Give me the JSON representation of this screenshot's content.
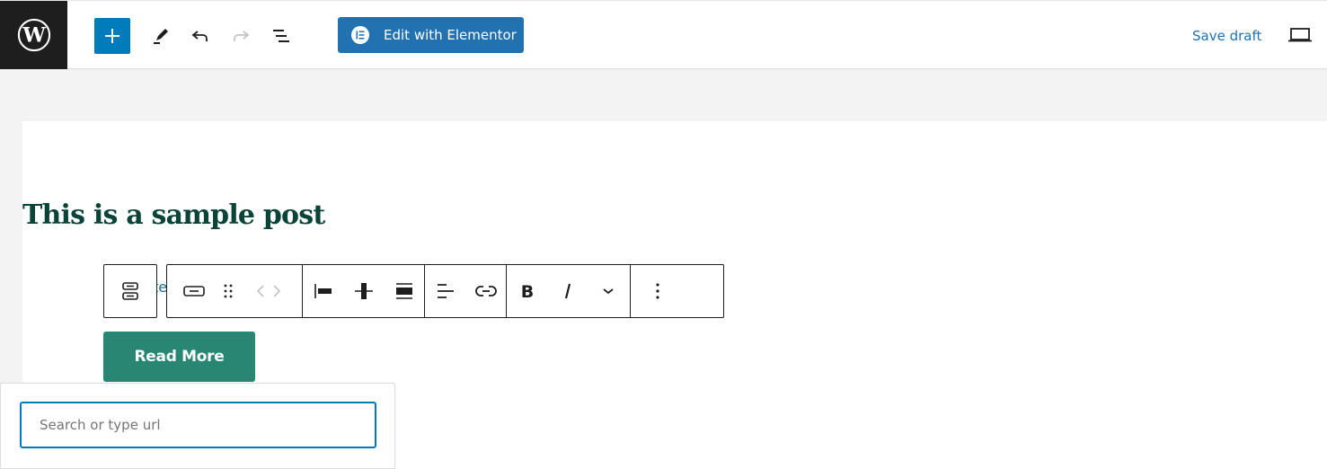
{
  "header": {
    "logo": "wordpress-logo",
    "add_block_label": "+",
    "tools": [
      {
        "name": "tools-icon",
        "label": "Tools"
      },
      {
        "name": "undo-icon",
        "label": "Undo"
      },
      {
        "name": "redo-icon",
        "label": "Redo",
        "disabled": true
      },
      {
        "name": "list-view-icon",
        "label": "Document Overview"
      }
    ],
    "elementor_label": "Edit with Elementor",
    "save_draft_label": "Save draft",
    "preview_icon": "laptop-icon"
  },
  "colors": {
    "accent": "#007cba",
    "elementor": "#2271b1",
    "title": "#0a4438",
    "button": "#288673",
    "dark": "#1e1e1e"
  },
  "post": {
    "title": "This is a sample post",
    "partial_text": "te",
    "button_label": "Read More"
  },
  "block_toolbar": {
    "groups": [
      [
        {
          "name": "buttons-parent-icon",
          "label": "Select Buttons"
        }
      ],
      [
        {
          "name": "button-block-icon",
          "label": "Button"
        },
        {
          "name": "drag-handle-icon",
          "label": "Drag"
        },
        {
          "name": "move-arrows-icon",
          "label": "Move left/right"
        }
      ],
      [
        {
          "name": "align-left-icon",
          "label": "Align left"
        },
        {
          "name": "align-center-icon",
          "label": "Align center"
        },
        {
          "name": "align-wide-icon",
          "label": "Wide width"
        }
      ],
      [
        {
          "name": "justify-icon",
          "label": "Change items justification"
        },
        {
          "name": "link-icon",
          "label": "Link"
        }
      ],
      [
        {
          "name": "bold-icon",
          "label": "Bold"
        },
        {
          "name": "italic-icon",
          "label": "Italic"
        },
        {
          "name": "more-chevron-icon",
          "label": "More"
        }
      ],
      [
        {
          "name": "options-icon",
          "label": "Options"
        }
      ]
    ]
  },
  "link_popover": {
    "input_value": "",
    "input_placeholder": "Search or type url"
  }
}
